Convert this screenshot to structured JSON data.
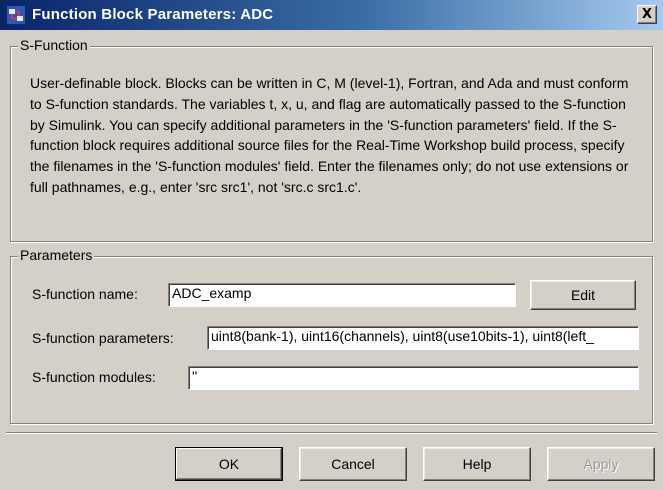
{
  "window": {
    "title": "Function Block Parameters: ADC",
    "close_glyph": "X"
  },
  "sfunction_group": {
    "legend": "S-Function",
    "description": "User-definable block.  Blocks can be written in C, M (level-1), Fortran, and Ada and must conform to S-function standards.  The variables t, x, u, and flag are automatically passed to the S-function by Simulink.  You can specify additional parameters in the 'S-function parameters' field. If the S-function block requires additional source files for the Real-Time Workshop build process, specify the filenames in the 'S-function modules' field. Enter the filenames only; do not use extensions or full pathnames, e.g., enter 'src src1', not 'src.c src1.c'."
  },
  "parameters_group": {
    "legend": "Parameters",
    "name_label": "S-function name:",
    "name_value": "ADC_examp",
    "edit_label": "Edit",
    "params_label": "S-function parameters:",
    "params_value": "uint8(bank-1), uint16(channels), uint8(use10bits-1), uint8(left_",
    "modules_label": "S-function modules:",
    "modules_value": "''"
  },
  "buttons": {
    "ok": "OK",
    "cancel": "Cancel",
    "help": "Help",
    "apply": "Apply"
  },
  "icons": {
    "app": "simulink-block-icon",
    "close": "close-icon"
  }
}
